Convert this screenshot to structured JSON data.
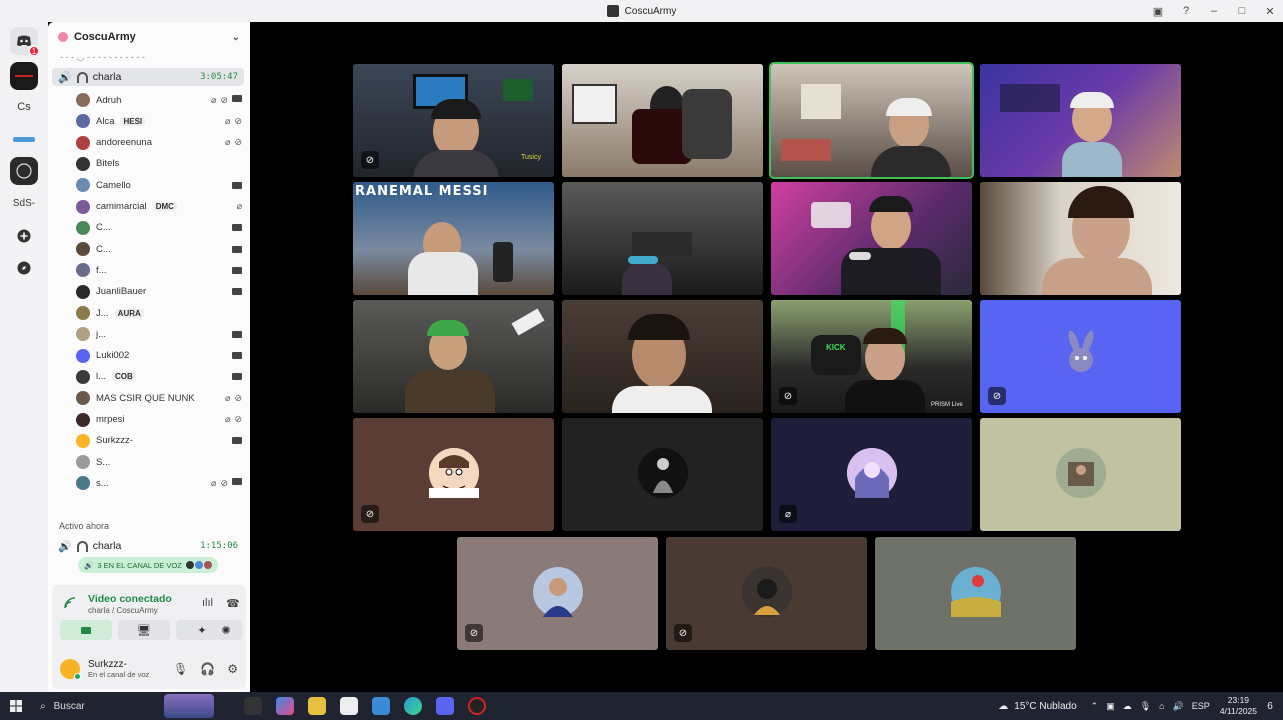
{
  "window": {
    "title": "CoscuArmy"
  },
  "rail": {
    "notification_count": "1",
    "items": [
      "Cs",
      "SdS-"
    ]
  },
  "server": {
    "name": "CoscuArmy"
  },
  "voice_channel": {
    "name": "charla",
    "timer": "3:05:47"
  },
  "members": [
    {
      "name": "Adruh",
      "color": "#8a6a5a"
    },
    {
      "name": "Alca",
      "tag": "HESI",
      "color": "#5a6aa0"
    },
    {
      "name": "andoreenuna",
      "color": "#b04040"
    },
    {
      "name": "Bitels",
      "color": "#333333"
    },
    {
      "name": "Camello",
      "color": "#6a8ab0"
    },
    {
      "name": "camimarcial",
      "tag": "DMC",
      "color": "#7a5a9a"
    },
    {
      "name": "C...",
      "color": "#4a8a5a"
    },
    {
      "name": "C...",
      "color": "#5a4a3a"
    },
    {
      "name": "f...",
      "color": "#6a6a8a"
    },
    {
      "name": "JuanliBauer",
      "color": "#2a2a2a"
    },
    {
      "name": "J...",
      "tag": "AURA",
      "color": "#8a7a4a"
    },
    {
      "name": "j...",
      "color": "#b0a080"
    },
    {
      "name": "Luki002",
      "color": "#5865f2"
    },
    {
      "name": "l...",
      "tag": "COB",
      "color": "#3a3a3a"
    },
    {
      "name": "MAS CSIR QUE NUNK",
      "color": "#6a5a4a"
    },
    {
      "name": "mrpesi",
      "color": "#3a2a2a"
    },
    {
      "name": "Surkzzz-",
      "color": "#f5b325"
    },
    {
      "name": "S...",
      "color": "#9a9a9a"
    },
    {
      "name": "s...",
      "color": "#4a7a8a"
    }
  ],
  "active_now": {
    "title": "Activo ahora",
    "channel": "charla",
    "timer": "1:15:06",
    "pill": "3 EN EL CANAL DE VOZ"
  },
  "voice_panel": {
    "status": "Video conectado",
    "location": "charla / CoscuArmy"
  },
  "user": {
    "name": "Surkzzz-",
    "status": "En el canal de voz"
  },
  "tile_labels": {
    "t1_sign": "Tusicy",
    "t5_banner": "RANEMAL MESSI",
    "t11_sign": "KICK",
    "t11_brand": "PRISM Live"
  },
  "taskbar": {
    "search": "Buscar",
    "weather": "15°C  Nublado",
    "lang": "ESP",
    "time": "23:19",
    "date": "4/11/2025",
    "notif": "6"
  }
}
